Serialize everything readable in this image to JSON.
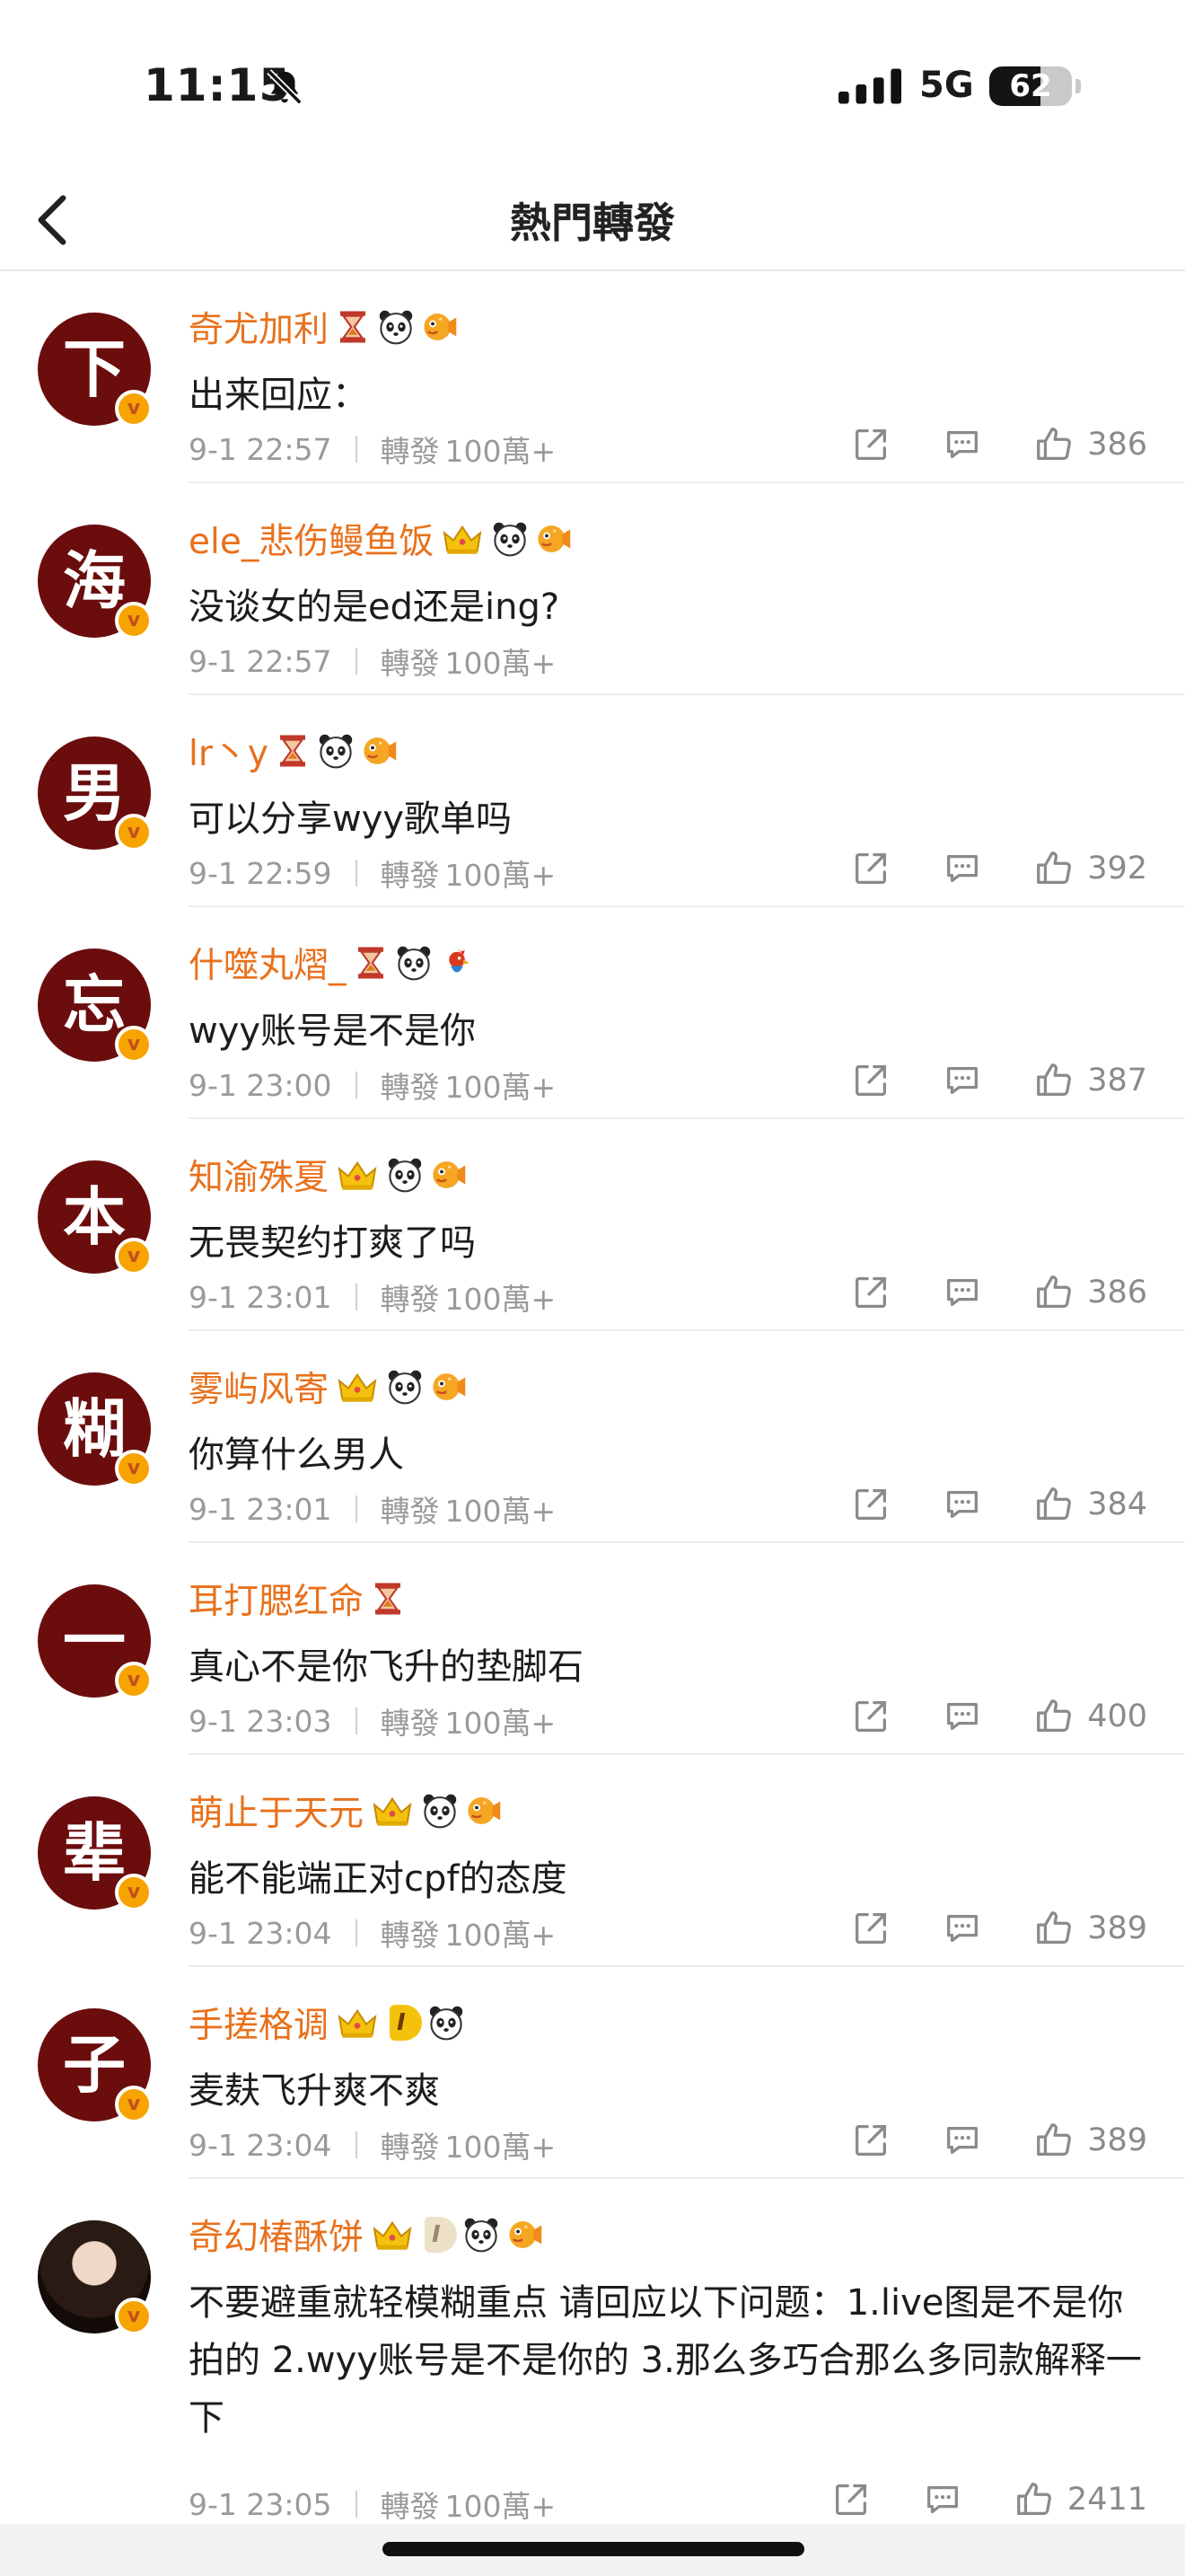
{
  "status_bar": {
    "time": "11:15",
    "network": "5G",
    "battery": "62",
    "battery_level": 0.62
  },
  "nav": {
    "title": "熱門轉發"
  },
  "labels": {
    "repost_prefix": "轉發"
  },
  "colors": {
    "username": "#e8711c",
    "avatar_bg": "#6b0d0d",
    "verified_badge": "#f7a300"
  },
  "comments": [
    {
      "avatar_char": "下",
      "username": "奇尤加利",
      "badges": [
        "hourglass-icon",
        "panda-icon",
        "pufferfish-icon"
      ],
      "text": "出来回应：",
      "time": "9-1 22:57",
      "reposts": "100萬+",
      "likes": "386",
      "show_actions": true
    },
    {
      "avatar_char": "海",
      "username": "ele_悲伤鳗鱼饭",
      "badges": [
        "crown-icon",
        "panda-icon",
        "pufferfish-icon"
      ],
      "text": "没谈女的是ed还是ing?",
      "time": "9-1 22:57",
      "reposts": "100萬+",
      "likes": "",
      "show_actions": false
    },
    {
      "avatar_char": "男",
      "username": "lr丶y",
      "badges": [
        "hourglass-icon",
        "panda-icon",
        "pufferfish-icon"
      ],
      "text": "可以分享wyy歌单吗",
      "time": "9-1 22:59",
      "reposts": "100萬+",
      "likes": "392",
      "show_actions": true
    },
    {
      "avatar_char": "忘",
      "username": "什噬丸熠_",
      "badges": [
        "hourglass-icon",
        "panda-icon",
        "rooster-icon"
      ],
      "text": "wyy账号是不是你",
      "time": "9-1 23:00",
      "reposts": "100萬+",
      "likes": "387",
      "show_actions": true
    },
    {
      "avatar_char": "本",
      "username": "知渝殊夏",
      "badges": [
        "crown-icon",
        "panda-icon",
        "pufferfish-icon"
      ],
      "text": "无畏契约打爽了吗",
      "time": "9-1 23:01",
      "reposts": "100萬+",
      "likes": "386",
      "show_actions": true
    },
    {
      "avatar_char": "糊",
      "username": "雾屿风寄",
      "badges": [
        "crown-icon",
        "panda-icon",
        "pufferfish-icon"
      ],
      "text": "你算什么男人",
      "time": "9-1 23:01",
      "reposts": "100萬+",
      "likes": "384",
      "show_actions": true
    },
    {
      "avatar_char": "一",
      "username": "耳打腮红命",
      "badges": [
        "hourglass-icon"
      ],
      "text": "真心不是你飞升的垫脚石",
      "time": "9-1 23:03",
      "reposts": "100萬+",
      "likes": "400",
      "show_actions": true
    },
    {
      "avatar_char": "辈",
      "username": "萌止于天元",
      "badges": [
        "crown-icon",
        "panda-icon",
        "pufferfish-icon"
      ],
      "text": "能不能端正对cpf的态度",
      "time": "9-1 23:04",
      "reposts": "100萬+",
      "likes": "389",
      "show_actions": true
    },
    {
      "avatar_char": "子",
      "username": "手搓格调",
      "badges": [
        "level-badge",
        "panda-icon"
      ],
      "level": "I",
      "text": "麦麸飞升爽不爽",
      "time": "9-1 23:04",
      "reposts": "100萬+",
      "likes": "389",
      "show_actions": true
    },
    {
      "avatar_char": "",
      "avatar_photo": true,
      "username": "奇幻椿酥饼",
      "badges": [
        "level-badge-pale",
        "panda-icon",
        "pufferfish-icon"
      ],
      "level": "I",
      "text": "不要避重就轻模糊重点 请回应以下问题：1.live图是不是你拍的 2.wyy账号是不是你的 3.那么多巧合那么多同款解释一下",
      "time": "9-1 23:05",
      "reposts": "100萬+",
      "likes": "2411",
      "show_actions": true
    }
  ]
}
